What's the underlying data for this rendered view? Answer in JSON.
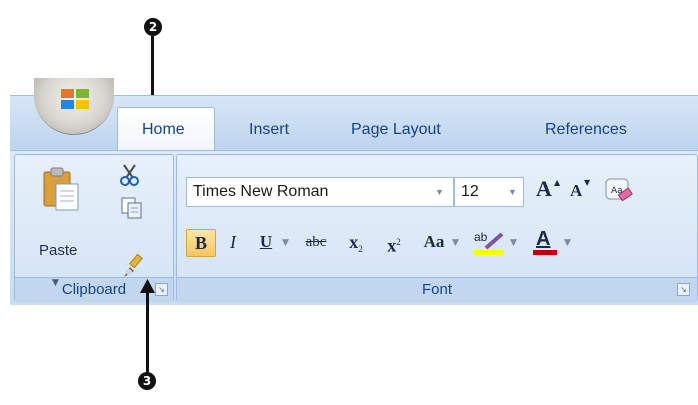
{
  "callouts": [
    {
      "label": "2"
    },
    {
      "label": "3"
    }
  ],
  "tabs": [
    {
      "label": "Home",
      "active": true
    },
    {
      "label": "Insert",
      "active": false
    },
    {
      "label": "Page Layout",
      "active": false
    },
    {
      "label": "References",
      "active": false
    }
  ],
  "clipboard": {
    "paste_label": "Paste",
    "group_label": "Clipboard",
    "cut_icon": "scissors-icon",
    "copy_icon": "copy-icon",
    "format_painter_icon": "paintbrush-icon"
  },
  "font": {
    "group_label": "Font",
    "font_name": "Times New Roman",
    "font_size": "12",
    "grow_font": "A",
    "shrink_font": "A",
    "bold": "B",
    "italic": "I",
    "underline": "U",
    "strikethrough": "abc",
    "subscript_base": "x",
    "subscript_sub": "2",
    "superscript_base": "x",
    "superscript_sup": "2",
    "change_case": "Aa",
    "highlight_text": "ab",
    "font_color_letter": "A"
  },
  "colors": {
    "ribbon_text": "#15428b",
    "highlight": "#ffff00",
    "font_color": "#c00000"
  }
}
